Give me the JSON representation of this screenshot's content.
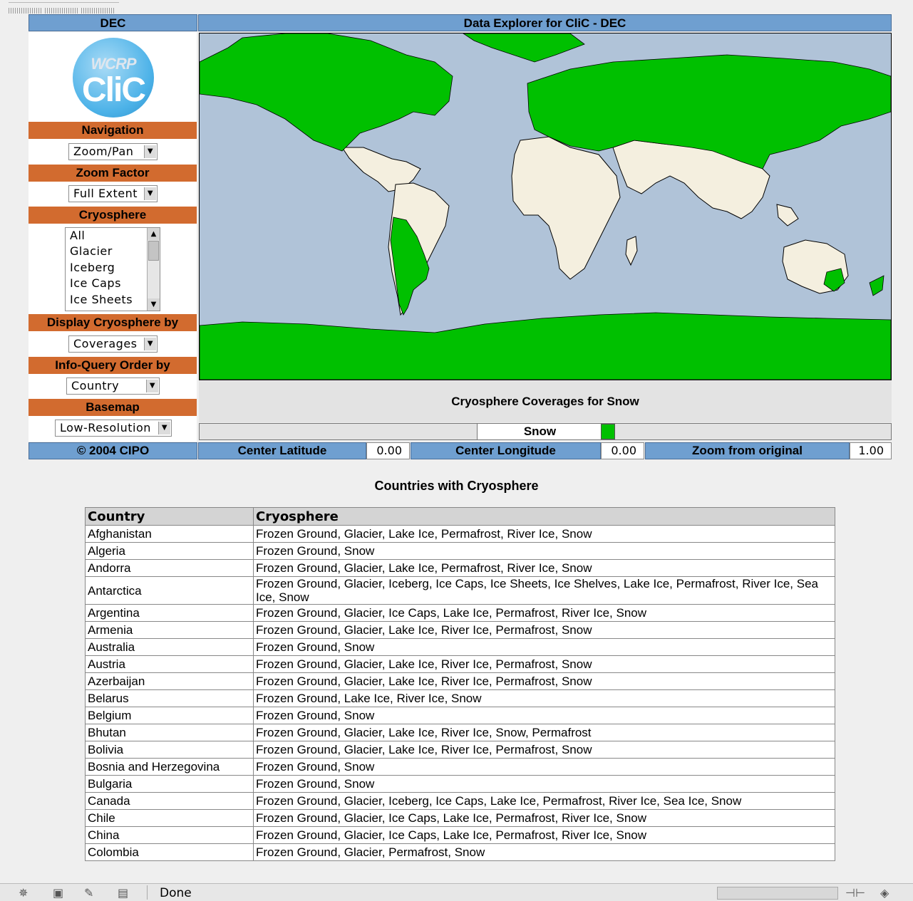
{
  "window": {
    "status_text": "Done"
  },
  "header": {
    "left_title": "DEC",
    "main_title": "Data Explorer for CliC - DEC"
  },
  "logo": {
    "line1": "WCRP",
    "line2": "CliC"
  },
  "sidebar": {
    "navigation": {
      "label": "Navigation",
      "value": "Zoom/Pan"
    },
    "zoom_factor": {
      "label": "Zoom Factor",
      "value": "Full Extent"
    },
    "cryosphere": {
      "label": "Cryosphere",
      "options": [
        "All",
        "Glacier",
        "Iceberg",
        "Ice Caps",
        "Ice Sheets"
      ]
    },
    "display_by": {
      "label": "Display Cryosphere by",
      "value": "Coverages"
    },
    "order_by": {
      "label": "Info-Query Order by",
      "value": "Country"
    },
    "basemap": {
      "label": "Basemap",
      "value": "Low-Resolution"
    }
  },
  "map": {
    "caption": "Cryosphere Coverages for Snow",
    "legend_label": "Snow",
    "legend_color": "#00c000",
    "ocean_color": "#b0c3d8",
    "land_color": "#f4efdf"
  },
  "footer": {
    "copyright": "© 2004   CIPO",
    "center_lat_label": "Center Latitude",
    "center_lat": "0.00",
    "center_lon_label": "Center Longitude",
    "center_lon": "0.00",
    "zoom_label": "Zoom from original",
    "zoom": "1.00"
  },
  "table": {
    "title": "Countries with Cryosphere",
    "headers": [
      "Country",
      "Cryosphere"
    ],
    "rows": [
      [
        "Afghanistan",
        "Frozen Ground, Glacier, Lake Ice, Permafrost, River Ice, Snow"
      ],
      [
        "Algeria",
        "Frozen Ground, Snow"
      ],
      [
        "Andorra",
        "Frozen Ground, Glacier, Lake Ice, Permafrost, River Ice, Snow"
      ],
      [
        "Antarctica",
        "Frozen Ground, Glacier, Iceberg, Ice Caps, Ice Sheets, Ice Shelves, Lake Ice, Permafrost, River Ice, Sea Ice, Snow"
      ],
      [
        "Argentina",
        "Frozen Ground, Glacier, Ice Caps, Lake Ice, Permafrost, River Ice, Snow"
      ],
      [
        "Armenia",
        "Frozen Ground, Glacier, Lake Ice, River Ice, Permafrost, Snow"
      ],
      [
        "Australia",
        "Frozen Ground, Snow"
      ],
      [
        "Austria",
        "Frozen Ground, Glacier, Lake Ice, River Ice, Permafrost, Snow"
      ],
      [
        "Azerbaijan",
        "Frozen Ground, Glacier, Lake Ice, River Ice, Permafrost, Snow"
      ],
      [
        "Belarus",
        "Frozen Ground, Lake Ice, River Ice, Snow"
      ],
      [
        "Belgium",
        "Frozen Ground, Snow"
      ],
      [
        "Bhutan",
        "Frozen Ground, Glacier, Lake Ice, River Ice, Snow, Permafrost"
      ],
      [
        "Bolivia",
        "Frozen Ground, Glacier, Lake Ice, River Ice, Permafrost, Snow"
      ],
      [
        "Bosnia and Herzegovina",
        "Frozen Ground, Snow"
      ],
      [
        "Bulgaria",
        "Frozen Ground, Snow"
      ],
      [
        "Canada",
        "Frozen Ground, Glacier, Iceberg, Ice Caps, Lake Ice, Permafrost, River Ice, Sea Ice, Snow"
      ],
      [
        "Chile",
        "Frozen Ground, Glacier, Ice Caps, Lake Ice, Permafrost, River Ice, Snow"
      ],
      [
        "China",
        "Frozen Ground, Glacier, Ice Caps, Lake Ice, Permafrost, River Ice, Snow"
      ],
      [
        "Colombia",
        "Frozen Ground, Glacier, Permafrost, Snow"
      ]
    ]
  }
}
